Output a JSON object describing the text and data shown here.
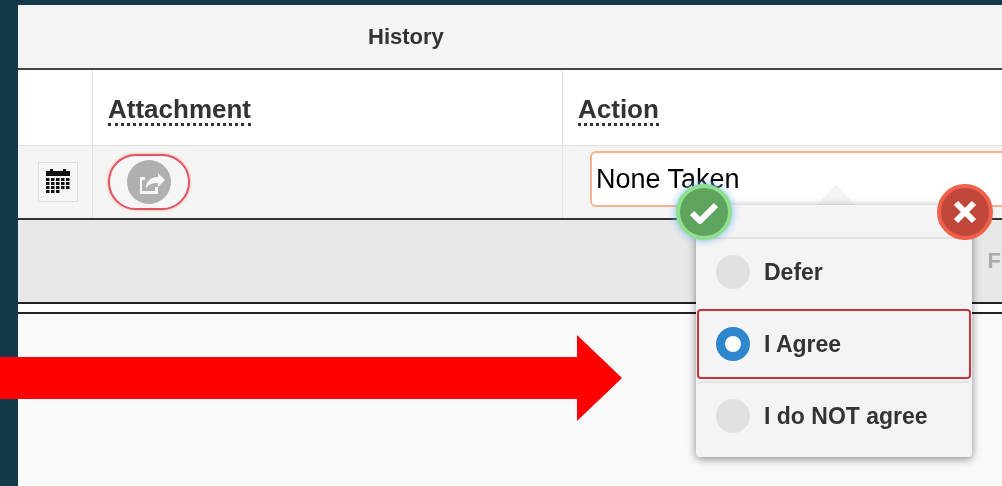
{
  "header": {
    "title": "History"
  },
  "table": {
    "columns": [
      {
        "label": "Attachment"
      },
      {
        "label": "Action"
      }
    ],
    "rows": [
      {
        "action": "None Taken"
      }
    ],
    "footer_row": {
      "column_3": "F"
    }
  },
  "popup": {
    "options": [
      {
        "label": "Defer",
        "selected": false
      },
      {
        "label": "I Agree",
        "selected": true
      },
      {
        "label": "I do NOT agree",
        "selected": false
      }
    ]
  }
}
